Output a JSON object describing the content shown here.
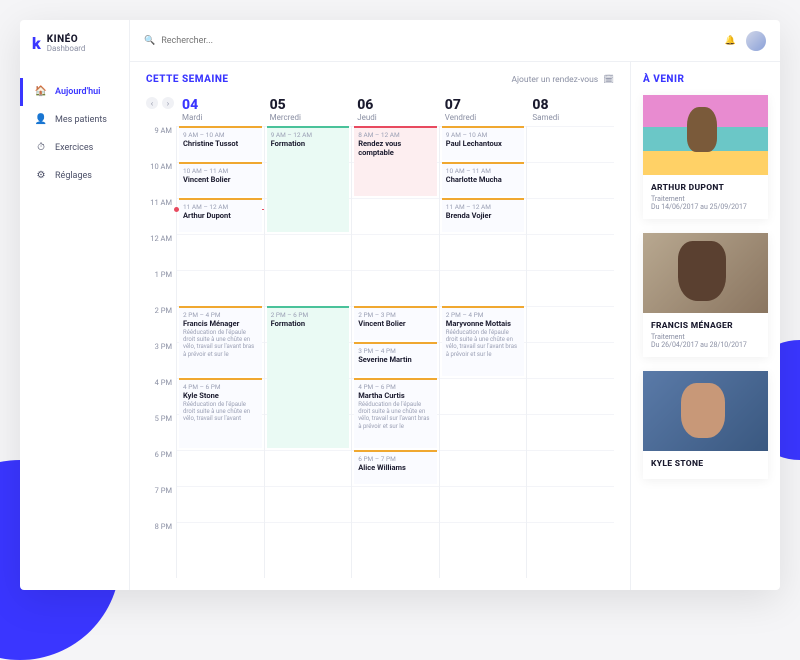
{
  "brand": {
    "title": "KINÉO",
    "subtitle": "Dashboard"
  },
  "nav": [
    {
      "label": "Aujourd'hui",
      "icon": "🏠",
      "name": "nav-today",
      "active": true
    },
    {
      "label": "Mes patients",
      "icon": "👤",
      "name": "nav-patients",
      "active": false
    },
    {
      "label": "Exercices",
      "icon": "⏱",
      "name": "nav-exercises",
      "active": false
    },
    {
      "label": "Réglages",
      "icon": "⚙",
      "name": "nav-settings",
      "active": false
    }
  ],
  "search": {
    "placeholder": "Rechercher..."
  },
  "calendar": {
    "title": "CETTE SEMAINE",
    "add_label": "Ajouter un rendez-vous",
    "days": [
      {
        "num": "04",
        "name": "Mardi",
        "active": true
      },
      {
        "num": "05",
        "name": "Mercredi",
        "active": false
      },
      {
        "num": "06",
        "name": "Jeudi",
        "active": false
      },
      {
        "num": "07",
        "name": "Vendredi",
        "active": false
      },
      {
        "num": "08",
        "name": "Samedi",
        "active": false
      }
    ],
    "hours": [
      "9 AM",
      "10 AM",
      "11 AM",
      "12 AM",
      "1 PM",
      "2 PM",
      "3 PM",
      "4 PM",
      "5 PM",
      "6 PM",
      "7 PM",
      "8 PM"
    ],
    "now_row": 2.3,
    "events": [
      {
        "day": 0,
        "start": 0,
        "span": 1,
        "time": "9 AM – 10 AM",
        "title": "Christine Tussot",
        "color": "#f0a830"
      },
      {
        "day": 0,
        "start": 1,
        "span": 1,
        "time": "10 AM – 11 AM",
        "title": "Vincent Bolier",
        "color": "#f0a830"
      },
      {
        "day": 0,
        "start": 2,
        "span": 1,
        "time": "11 AM – 12 AM",
        "title": "Arthur Dupont",
        "color": "#f0a830"
      },
      {
        "day": 0,
        "start": 5,
        "span": 2,
        "time": "2 PM – 4 PM",
        "title": "Francis Ménager",
        "desc": "Rééducation de l'épaule droit suite à une chûte en vélo, travail sur l'avant bras à prévoir et sur le",
        "color": "#f0a830"
      },
      {
        "day": 0,
        "start": 7,
        "span": 2,
        "time": "4 PM – 6 PM",
        "title": "Kyle Stone",
        "desc": "Rééducation de l'épaule droit suite à une chûte en vélo, travail sur l'avant",
        "color": "#f0a830"
      },
      {
        "day": 1,
        "start": 0,
        "span": 3,
        "time": "9 AM – 12 AM",
        "title": "Formation",
        "color": "#4ac29a",
        "bg": "#eafaf4"
      },
      {
        "day": 1,
        "start": 5,
        "span": 4,
        "time": "2 PM – 6 PM",
        "title": "Formation",
        "color": "#4ac29a",
        "bg": "#eafaf4"
      },
      {
        "day": 2,
        "start": 0,
        "span": 2,
        "time": "8 AM – 12 AM",
        "title": "Rendez vous comptable",
        "color": "#e84a5f",
        "bg": "#fdeef0"
      },
      {
        "day": 2,
        "start": 5,
        "span": 1,
        "time": "2 PM – 3 PM",
        "title": "Vincent Bolier",
        "color": "#f0a830"
      },
      {
        "day": 2,
        "start": 6,
        "span": 1,
        "time": "3 PM – 4 PM",
        "title": "Severine Martin",
        "color": "#f0a830"
      },
      {
        "day": 2,
        "start": 7,
        "span": 2,
        "time": "4 PM – 6 PM",
        "title": "Martha Curtis",
        "desc": "Rééducation de l'épaule droit suite à une chûte en vélo, travail sur l'avant bras à prévoir et sur le",
        "color": "#f0a830"
      },
      {
        "day": 2,
        "start": 9,
        "span": 1,
        "time": "6 PM – 7 PM",
        "title": "Alice Williams",
        "color": "#f0a830"
      },
      {
        "day": 3,
        "start": 0,
        "span": 1,
        "time": "9 AM – 10 AM",
        "title": "Paul Lechantoux",
        "color": "#f0a830"
      },
      {
        "day": 3,
        "start": 1,
        "span": 1,
        "time": "10 AM – 11 AM",
        "title": "Charlotte Mucha",
        "color": "#f0a830"
      },
      {
        "day": 3,
        "start": 2,
        "span": 1,
        "time": "11 AM – 12 AM",
        "title": "Brenda Vojier",
        "color": "#f0a830"
      },
      {
        "day": 3,
        "start": 5,
        "span": 2,
        "time": "2 PM – 4 PM",
        "title": "Maryvonne Mottais",
        "desc": "Rééducation de l'épaule droit suite à une chûte en vélo, travail sur l'avant bras à prévoir et sur le",
        "color": "#f0a830"
      }
    ]
  },
  "upcoming": {
    "title": "À VENIR",
    "items": [
      {
        "name": "ARTHUR DUPONT",
        "sub": "Traitement",
        "date": "Du 14/06/2017 au 25/09/2017",
        "img": "img1"
      },
      {
        "name": "FRANCIS MÉNAGER",
        "sub": "Traitement",
        "date": "Du 26/04/2017 au 28/10/2017",
        "img": "img2"
      },
      {
        "name": "KYLE STONE",
        "sub": "",
        "date": "",
        "img": "img3"
      }
    ]
  }
}
